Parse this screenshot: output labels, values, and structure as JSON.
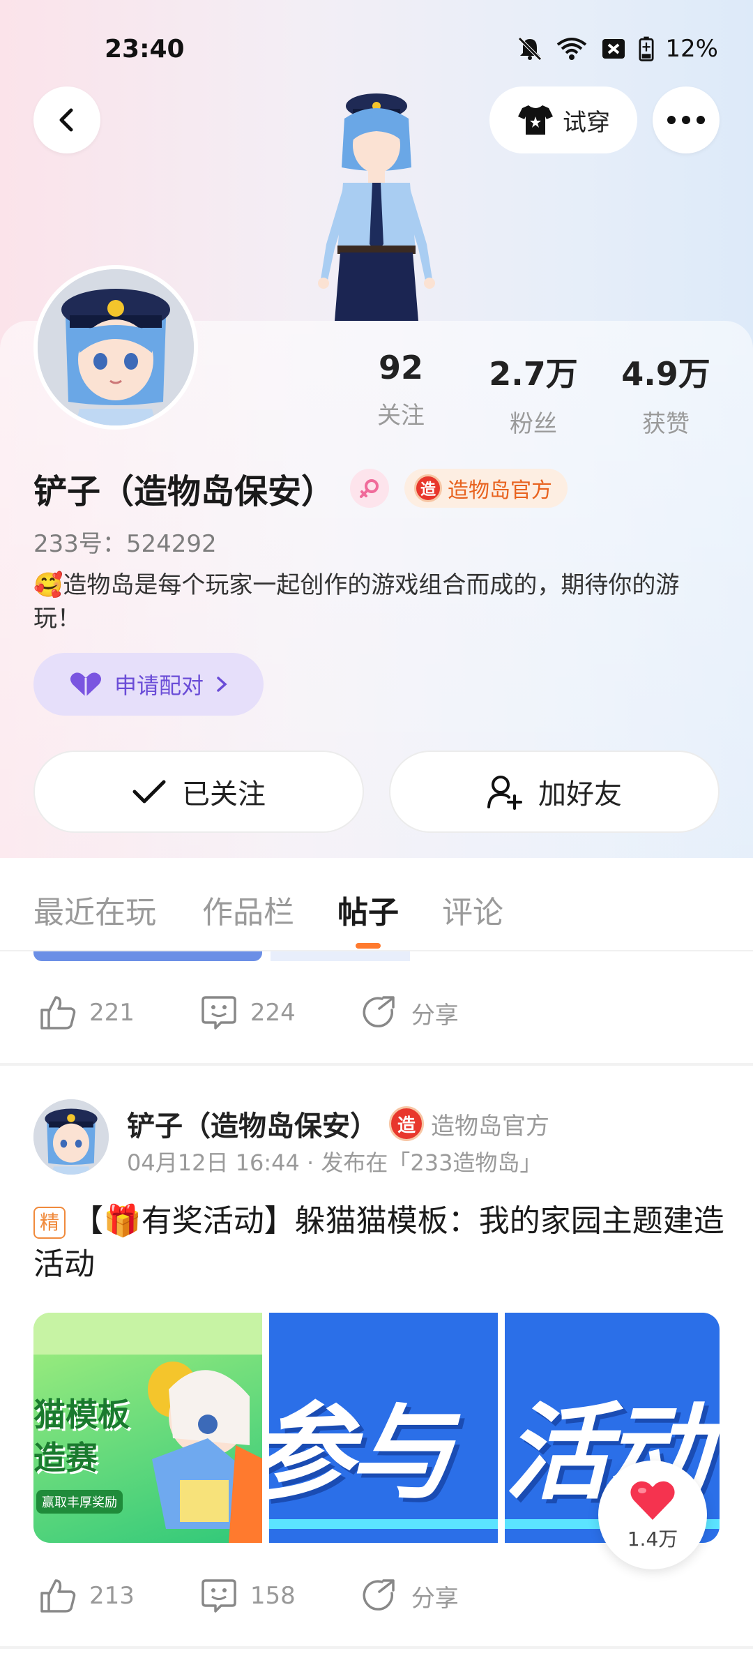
{
  "status_bar": {
    "time": "23:40",
    "battery": "12%"
  },
  "header": {
    "tryon_label": "试穿"
  },
  "profile": {
    "name": "铲子（造物岛保安）",
    "official_label": "造物岛官方",
    "zao_char": "造",
    "uid": "233号：524292",
    "bio": "🥰造物岛是每个玩家一起创作的游戏组合而成的，期待你的游玩！",
    "pair_label": "申请配对",
    "stats": [
      {
        "value": "92",
        "label": "关注"
      },
      {
        "value": "2.7万",
        "label": "粉丝"
      },
      {
        "value": "4.9万",
        "label": "获赞"
      }
    ],
    "follow_label": "已关注",
    "add_friend_label": "加好友"
  },
  "tabs": [
    "最近在玩",
    "作品栏",
    "帖子",
    "评论"
  ],
  "active_tab": "帖子",
  "prev_post": {
    "likes": "221",
    "comments": "224",
    "share": "分享"
  },
  "post": {
    "author": "铲子（造物岛保安）",
    "official_label": "造物岛官方",
    "meta": "04月12日 16:44 · 发布在「233造物岛」",
    "jing": "精",
    "title": "【🎁有奖活动】躲猫猫模板：我的家园主题建造活动",
    "image1_text_a": "猫模板",
    "image1_text_b": "造赛",
    "image1_caption": "赢取丰厚奖励",
    "banner_text_a": "参与",
    "banner_text_b": "活动",
    "likes": "213",
    "comments": "158",
    "share": "分享"
  },
  "float_like": {
    "count": "1.4万"
  },
  "colors": {
    "accent": "#ff7a2e",
    "pair": "#6a4cd7",
    "official": "#e8621e"
  }
}
